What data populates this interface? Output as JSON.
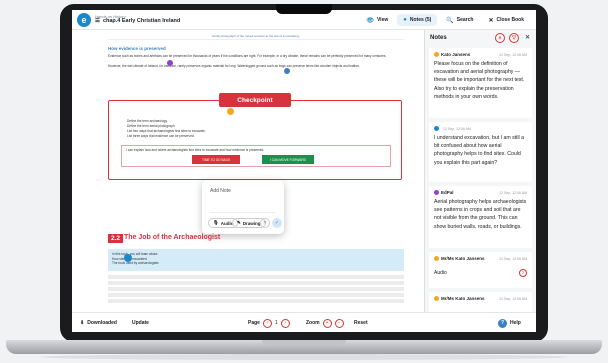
{
  "colors": {
    "accent": "#d8323e",
    "brand_blue": "#1b88c9",
    "link_blue": "#3d7fc7",
    "success_green": "#1f8f4e"
  },
  "header": {
    "subject": "Hands on History",
    "chapter": "chap.4 Early Christian Ireland",
    "view_label": "View",
    "notes_label": "Notes (5)",
    "search_label": "Search",
    "close_label": "Close Book"
  },
  "doc": {
    "image_caption": "Aerial photograph of the ruined remains at the site of a monastery.",
    "heading_preserved": "How evidence is preserved",
    "para1": "Evidence such as bones and artefacts can be preserved for thousands of years if the conditions are right. For example, in a dry climate, these remains can be perfectly preserved for many centuries.",
    "para2": "However, the wet climate of Ireland, for instance, rarely preserves organic material for long. Waterlogged ground such as bogs can preserve items like wooden objects and leather.",
    "checkpoint_title": "Checkpoint",
    "cp_items": [
      "Define the term archaeology.",
      "Define the term aerial photograph.",
      "List four ways that archaeologists find sites to excavate.",
      "List three ways that evidence can be preserved."
    ],
    "cp_prompt": "I can explain how and where archaeologists find sites to excavate and how evidence is preserved.",
    "cp_back": "TIME TO GO BACK",
    "cp_forward": "I CAN MOVE FORWARD",
    "add_note_title": "Add Note",
    "audio_label": "Audio",
    "drawing_label": "Drawing",
    "section_number": "2.2",
    "section_title": "The Job of the Archaeologist",
    "topic_intro": "In this topic, you will learn about:",
    "topic_items": [
      "How sites are excavated",
      "The tools used by archaeologists"
    ]
  },
  "notes": {
    "title": "Notes",
    "items": [
      {
        "author": "Kato Jansens",
        "date": "12 Sep, 12:06 AM",
        "text": "Please focus on the definition of excavation and aerial photography — these will be important for the next test. Also try to explain the preservation methods in your own words."
      },
      {
        "author": "",
        "date": "12 Sep, 12:06 AM",
        "text": "I understand excavation, but I am still a bit confused about how aerial photography helps to find sites. Could you explain this part again?"
      },
      {
        "author": "EdPal",
        "date": "12 Sep, 12:06 AM",
        "text": "Aerial photography helps archaeologists see patterns in crops and soil that are not visible from the ground. This can show buried walls, roads, or buildings."
      },
      {
        "author": "Mr/Ms Kato Jansens",
        "date": "12 Sep, 12:06 AM",
        "audio": "Audio"
      },
      {
        "author": "Mr/Ms Kato Jansens",
        "date": "12 Sep, 12:06 AM"
      }
    ]
  },
  "bottom": {
    "downloaded": "Downloaded",
    "update": "Update",
    "page_label": "Page",
    "page_value": "1",
    "zoom_label": "Zoom",
    "reset": "Reset",
    "help": "Help"
  }
}
